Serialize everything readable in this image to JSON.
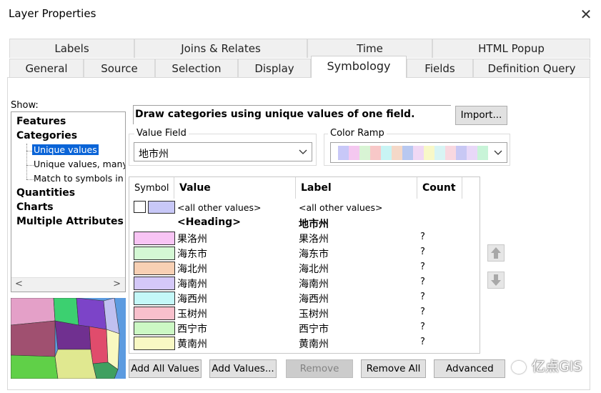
{
  "window": {
    "title": "Layer Properties",
    "close_glyph": "✕"
  },
  "tabs_row1": [
    "Labels",
    "Joins & Relates",
    "Time",
    "HTML Popup"
  ],
  "tabs_row2": [
    "General",
    "Source",
    "Selection",
    "Display",
    "Symbology",
    "Fields",
    "Definition Query"
  ],
  "active_tab": "Symbology",
  "show": {
    "label": "Show:",
    "items": [
      "Features",
      "Categories",
      "Quantities",
      "Charts",
      "Multiple Attributes"
    ],
    "sub_items": [
      "Unique values",
      "Unique values, many",
      "Match to symbols in a"
    ],
    "selected_sub": "Unique values"
  },
  "description": "Draw categories using unique values of one field.",
  "import_label": "Import...",
  "value_field": {
    "label": "Value Field",
    "value": "地市州"
  },
  "color_ramp": {
    "label": "Color Ramp",
    "colors": [
      "#c8c8f8",
      "#f4c8f0",
      "#d8f4d4",
      "#f8c8c8",
      "#c8f4f4",
      "#f4d8c8",
      "#b8c8f0",
      "#f0d8f4",
      "#f8f8c8",
      "#d8f4f4",
      "#f8d8e0",
      "#c8c8f4",
      "#e8d8f8",
      "#c8f4d8"
    ]
  },
  "grid": {
    "headers": [
      "Symbol",
      "Value",
      "Label",
      "Count"
    ],
    "other": {
      "value": "<all other values>",
      "label": "<all other values>",
      "color": "#c8c8f8"
    },
    "heading": {
      "value": "<Heading>",
      "label": "地市州"
    },
    "rows": [
      {
        "value": "果洛州",
        "label": "果洛州",
        "count": "?",
        "color": "#f8c4f4"
      },
      {
        "value": "海东市",
        "label": "海东市",
        "count": "?",
        "color": "#d4f8d4"
      },
      {
        "value": "海北州",
        "label": "海北州",
        "count": "?",
        "color": "#f8d0b4"
      },
      {
        "value": "海南州",
        "label": "海南州",
        "count": "?",
        "color": "#d4c8f8"
      },
      {
        "value": "海西州",
        "label": "海西州",
        "count": "?",
        "color": "#c4f8f8"
      },
      {
        "value": "玉树州",
        "label": "玉树州",
        "count": "?",
        "color": "#f8c0cc"
      },
      {
        "value": "西宁市",
        "label": "西宁市",
        "count": "?",
        "color": "#ccf8c4"
      },
      {
        "value": "黄南州",
        "label": "黄南州",
        "count": "?",
        "color": "#f8f8c4"
      }
    ]
  },
  "buttons": {
    "add_all": "Add All Values",
    "add_values": "Add Values...",
    "remove": "Remove",
    "remove_all": "Remove All",
    "advanced": "Advanced"
  },
  "watermark": "亿点GIS"
}
